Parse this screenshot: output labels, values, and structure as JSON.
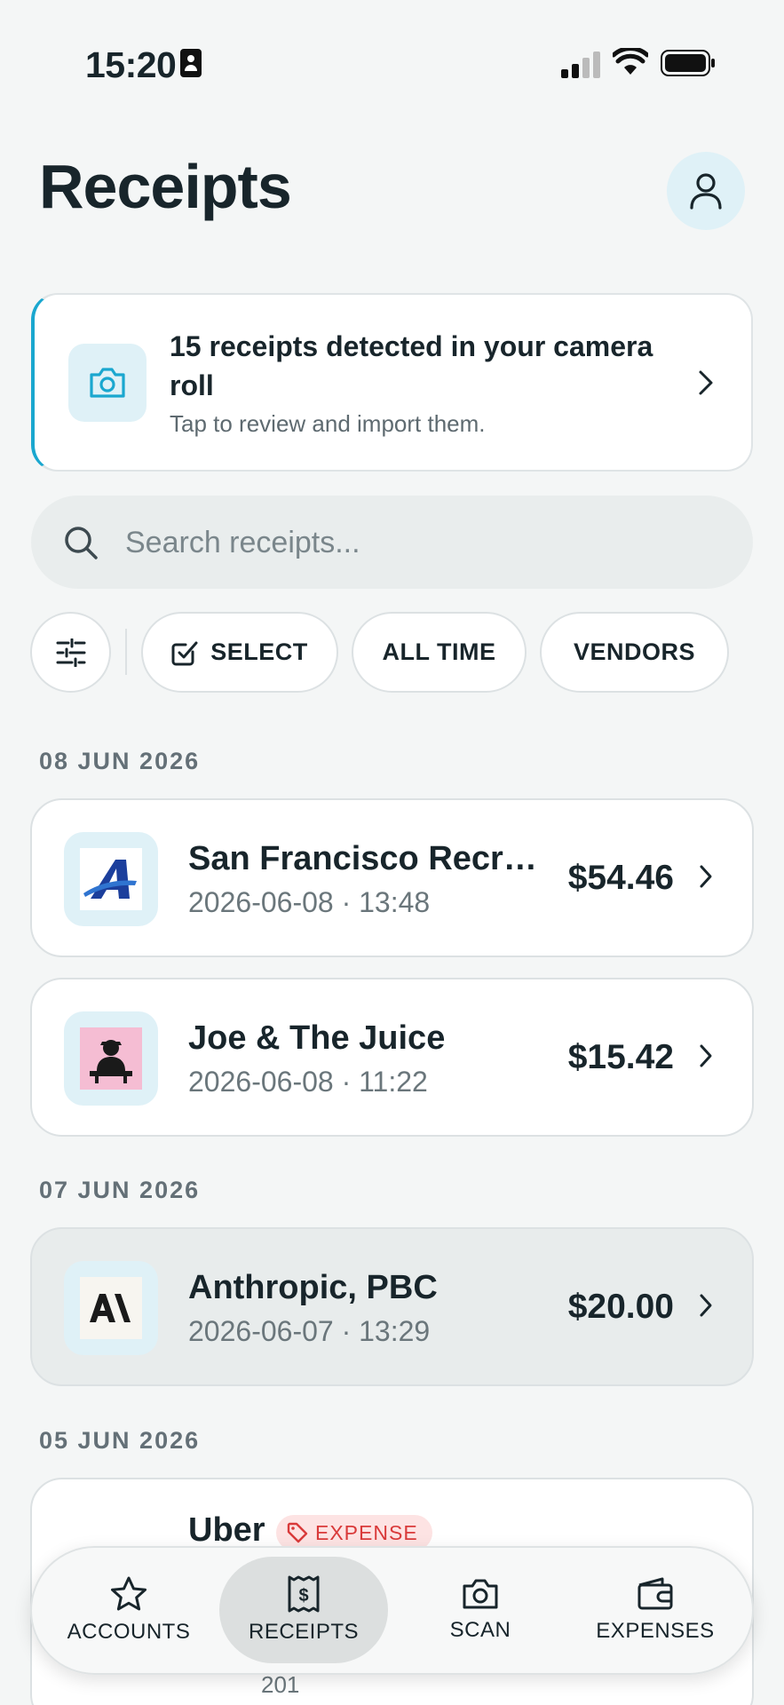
{
  "status_bar": {
    "time": "15:20"
  },
  "header": {
    "title": "Receipts"
  },
  "banner": {
    "title": "15 receipts detected in your camera roll",
    "subtitle": "Tap to review and import them."
  },
  "search": {
    "placeholder": "Search receipts...",
    "value": ""
  },
  "filters": {
    "select_label": "SELECT",
    "time_label": "ALL TIME",
    "vendors_label": "VENDORS"
  },
  "sections": [
    {
      "date": "08 JUN 2026",
      "receipts": [
        {
          "name": "San Francisco Recrea...",
          "datetime": "2026-06-08 · 13:48",
          "amount": "$54.46",
          "logo": "sf-rec-logo"
        },
        {
          "name": "Joe & The Juice",
          "datetime": "2026-06-08 · 11:22",
          "amount": "$15.42",
          "logo": "joe-juice-logo"
        }
      ]
    },
    {
      "date": "07 JUN 2026",
      "receipts": [
        {
          "name": "Anthropic, PBC",
          "datetime": "2026-06-07 · 13:29",
          "amount": "$20.00",
          "logo": "anthropic-logo"
        }
      ]
    },
    {
      "date": "05 JUN 2026",
      "receipts": [
        {
          "name": "Uber",
          "badge": "EXPENSE",
          "partial_text": "201"
        }
      ]
    }
  ],
  "bottom_nav": [
    {
      "label": "ACCOUNTS",
      "icon": "star-icon",
      "active": false
    },
    {
      "label": "RECEIPTS",
      "icon": "receipt-icon",
      "active": true
    },
    {
      "label": "SCAN",
      "icon": "camera-icon",
      "active": false
    },
    {
      "label": "EXPENSES",
      "icon": "wallet-icon",
      "active": false
    }
  ],
  "colors": {
    "accent": "#1aa7cf",
    "background": "#f4f6f6",
    "badge_red": "#d93a3a"
  }
}
